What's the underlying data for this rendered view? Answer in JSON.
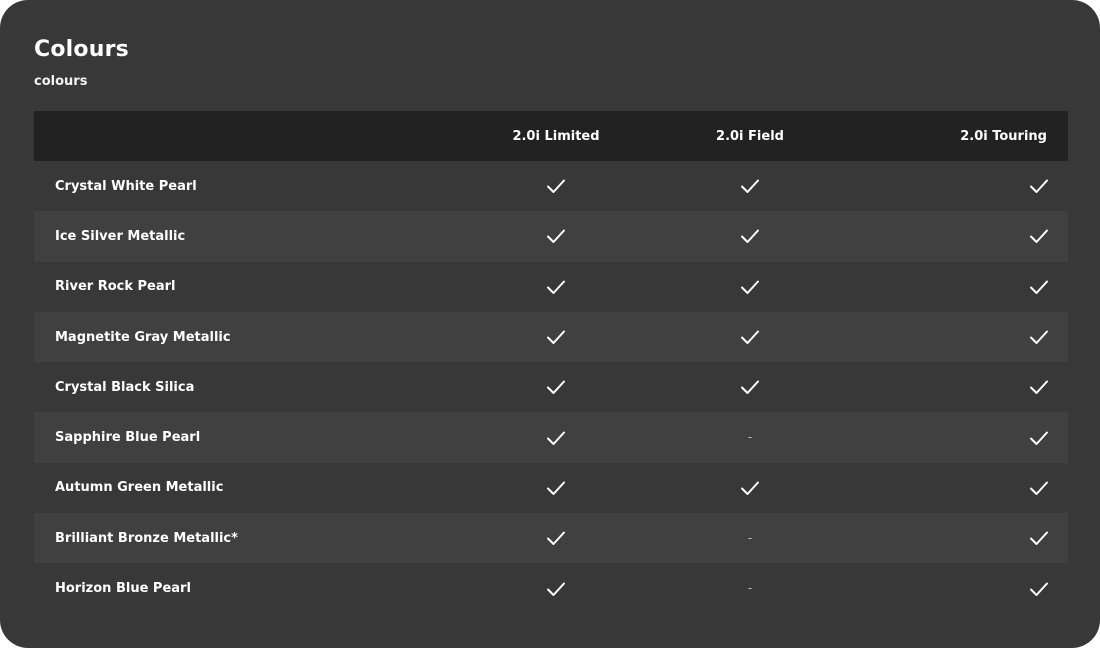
{
  "section": {
    "title": "Colours",
    "subtitle": "colours"
  },
  "table": {
    "headers": [
      "",
      "2.0i Limited",
      "2.0i Field",
      "2.0i Touring"
    ],
    "rows": [
      {
        "name": "Crystal White Pearl",
        "limited": "check",
        "field": "check",
        "touring": "check"
      },
      {
        "name": "Ice Silver Metallic",
        "limited": "check",
        "field": "check",
        "touring": "check"
      },
      {
        "name": "River Rock Pearl",
        "limited": "check",
        "field": "check",
        "touring": "check"
      },
      {
        "name": "Magnetite Gray Metallic",
        "limited": "check",
        "field": "check",
        "touring": "check"
      },
      {
        "name": "Crystal Black Silica",
        "limited": "check",
        "field": "check",
        "touring": "check"
      },
      {
        "name": "Sapphire Blue Pearl",
        "limited": "check",
        "field": "-",
        "touring": "check"
      },
      {
        "name": "Autumn Green Metallic",
        "limited": "check",
        "field": "check",
        "touring": "check"
      },
      {
        "name": "Brilliant Bronze Metallic*",
        "limited": "check",
        "field": "-",
        "touring": "check"
      },
      {
        "name": "Horizon Blue Pearl",
        "limited": "check",
        "field": "-",
        "touring": "check"
      }
    ]
  },
  "icons": {
    "available": "check-icon",
    "unavailable": "dash"
  },
  "colors": {
    "card_background": "#383838",
    "header_background": "#222222",
    "row_alt_background": "#404040",
    "text": "#ffffff"
  }
}
